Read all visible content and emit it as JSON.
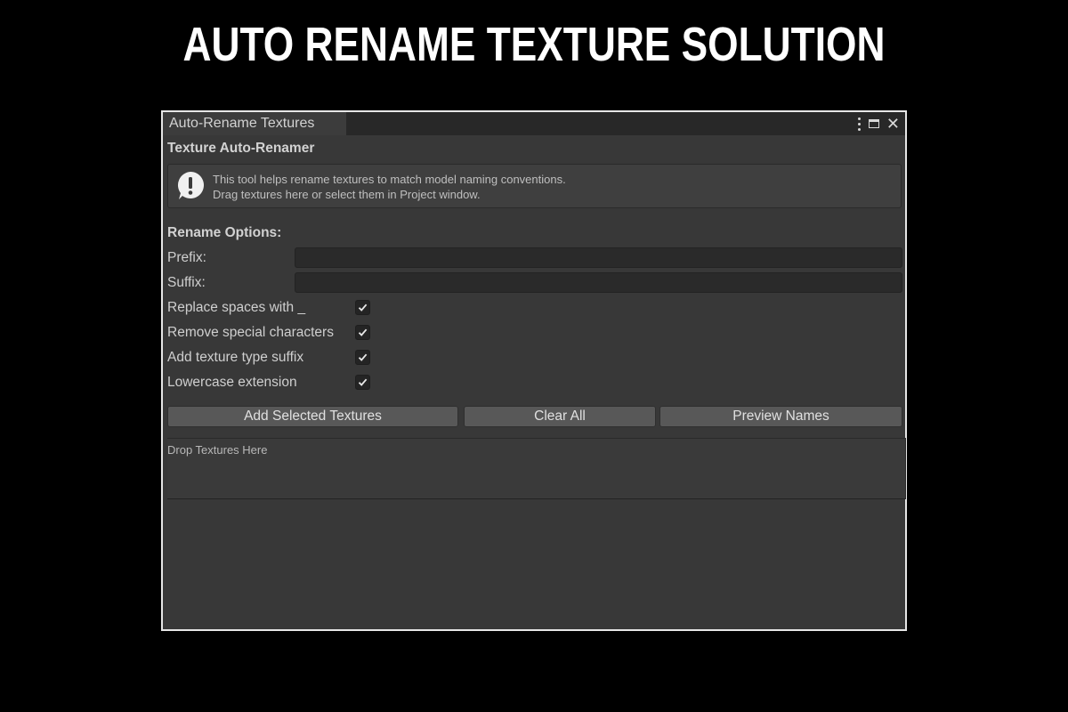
{
  "page": {
    "title": "AUTO RENAME TEXTURE SOLUTION"
  },
  "window": {
    "tab_title": "Auto-Rename Textures",
    "controls": {
      "menu_icon": "kebab-menu-icon",
      "maximize_icon": "maximize-icon",
      "close_icon": "close-icon"
    }
  },
  "panel": {
    "header": "Texture Auto-Renamer",
    "help": {
      "icon": "info-exclamation-icon",
      "line1": "This tool helps rename textures to match model naming conventions.",
      "line2": "Drag textures here or select them in Project window."
    },
    "options_header": "Rename Options:",
    "fields": {
      "prefix_label": "Prefix:",
      "prefix_value": "",
      "suffix_label": "Suffix:",
      "suffix_value": ""
    },
    "toggles": [
      {
        "label": "Replace spaces with _",
        "checked": true
      },
      {
        "label": "Remove special characters",
        "checked": true
      },
      {
        "label": "Add texture type suffix",
        "checked": true
      },
      {
        "label": "Lowercase extension",
        "checked": true
      }
    ],
    "buttons": {
      "add_selected": "Add Selected Textures",
      "clear_all": "Clear All",
      "preview_names": "Preview Names"
    },
    "dropzone_label": "Drop Textures Here"
  },
  "colors": {
    "page_background": "#000000",
    "window_background": "#383838",
    "button_background": "#585858",
    "input_background": "#2a2a2a"
  }
}
